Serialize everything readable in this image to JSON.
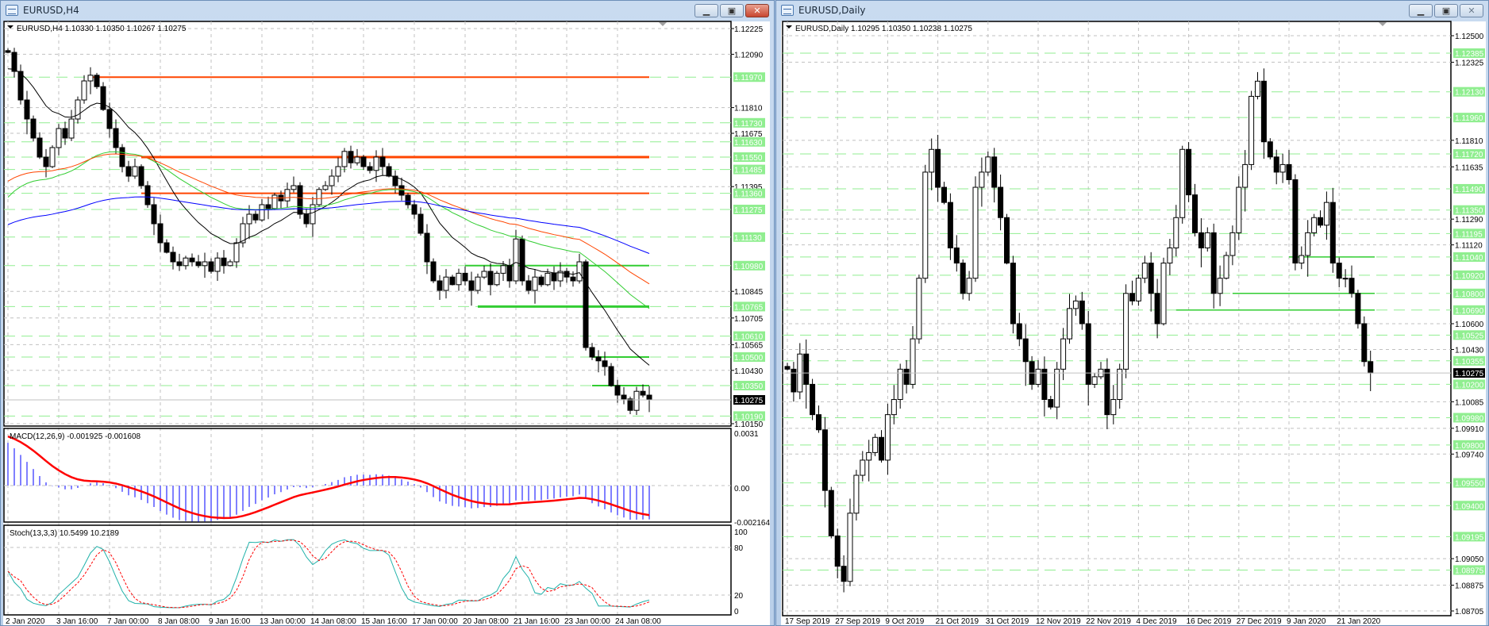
{
  "left": {
    "title": "EURUSD,H4",
    "info": "EURUSD,H4  1.10330 1.10350 1.10267 1.10275",
    "current_price": "1.10275",
    "price_labels": [
      "1.12225",
      "1.12090",
      "1.11810",
      "1.11675",
      "1.11395",
      "1.10845",
      "1.10705",
      "1.10565",
      "1.10430",
      "1.10150"
    ],
    "green_labels": [
      "1.11970",
      "1.11730",
      "1.11630",
      "1.11550",
      "1.11485",
      "1.11360",
      "1.11275",
      "1.11130",
      "1.10980",
      "1.10765",
      "1.10610",
      "1.10500",
      "1.10350",
      "1.10190"
    ],
    "levels": [
      {
        "price": 1.1197,
        "from_bar": 13,
        "color": "#ff4500",
        "weight": 2
      },
      {
        "price": 1.1155,
        "from_bar": 21,
        "color": "#ff4500",
        "weight": 3
      },
      {
        "price": 1.1136,
        "from_bar": 21,
        "color": "#ff4500",
        "weight": 2
      },
      {
        "price": 1.1098,
        "from_bar": 72,
        "color": "#32cd32",
        "weight": 2
      },
      {
        "price": 1.10765,
        "from_bar": 74,
        "color": "#32cd32",
        "weight": 3
      },
      {
        "price": 1.105,
        "from_bar": 92,
        "color": "#32cd32",
        "weight": 2
      },
      {
        "price": 1.1035,
        "from_bar": 92,
        "color": "#32cd32",
        "weight": 2
      }
    ],
    "dates": [
      "2 Jan 2020",
      "3 Jan 16:00",
      "7 Jan 00:00",
      "8 Jan 08:00",
      "9 Jan 16:00",
      "13 Jan 00:00",
      "14 Jan 08:00",
      "15 Jan 16:00",
      "17 Jan 00:00",
      "20 Jan 08:00",
      "21 Jan 16:00",
      "23 Jan 00:00",
      "24 Jan 08:00"
    ],
    "closes": [
      1.121,
      1.12,
      1.1185,
      1.1175,
      1.1165,
      1.1155,
      1.115,
      1.116,
      1.117,
      1.1165,
      1.1175,
      1.1185,
      1.1195,
      1.1198,
      1.1192,
      1.118,
      1.117,
      1.116,
      1.115,
      1.1145,
      1.115,
      1.114,
      1.113,
      1.112,
      1.111,
      1.1105,
      1.11,
      1.1098,
      1.1102,
      1.11,
      1.1098,
      1.11,
      1.1095,
      1.1102,
      1.1098,
      1.11,
      1.111,
      1.112,
      1.1125,
      1.1122,
      1.113,
      1.1128,
      1.1135,
      1.1132,
      1.1138,
      1.114,
      1.1125,
      1.112,
      1.113,
      1.1138,
      1.114,
      1.1145,
      1.115,
      1.1158,
      1.1152,
      1.1155,
      1.115,
      1.1148,
      1.1155,
      1.115,
      1.1145,
      1.114,
      1.1135,
      1.113,
      1.1125,
      1.1115,
      1.11,
      1.109,
      1.1085,
      1.1092,
      1.1088,
      1.1094,
      1.109,
      1.1085,
      1.1092,
      1.1095,
      1.1088,
      1.1094,
      1.1098,
      1.109,
      1.1112,
      1.109,
      1.1085,
      1.1092,
      1.1088,
      1.1094,
      1.109,
      1.1095,
      1.1092,
      1.109,
      1.11,
      1.1055,
      1.105,
      1.1048,
      1.1045,
      1.1035,
      1.103,
      1.1028,
      1.1022,
      1.1032,
      1.103,
      1.10275
    ],
    "ma_colors": [
      "#000000",
      "#32cd32",
      "#ff4500",
      "#0000ff"
    ],
    "macd": {
      "label": "MACD(12,26,9) -0.001925 -0.001608",
      "axis": [
        "0.0031",
        "0.00",
        "-0.002164"
      ],
      "hist_color": "#0000ff",
      "signal_color": "#ff0000"
    },
    "stoch": {
      "label": "Stoch(13,3,3) 10.5499 10.2189",
      "axis": [
        "100",
        "80",
        "20",
        "0"
      ],
      "main_color": "#20b2aa",
      "signal_color": "#ff0000"
    }
  },
  "right": {
    "title": "EURUSD,Daily",
    "info": "EURUSD,Daily  1.10295 1.10350 1.10238 1.10275",
    "current_price": "1.10275",
    "price_labels": [
      "1.12500",
      "1.12325",
      "1.11810",
      "1.11635",
      "1.11290",
      "1.11120",
      "1.10600",
      "1.10430",
      "1.10085",
      "1.09910",
      "1.09740",
      "1.09050",
      "1.08875",
      "1.08705"
    ],
    "green_labels": [
      "1.12385",
      "1.12130",
      "1.11960",
      "1.11720",
      "1.11490",
      "1.11350",
      "1.11195",
      "1.11040",
      "1.10920",
      "1.10800",
      "1.10690",
      "1.10525",
      "1.10355",
      "1.10200",
      "1.09980",
      "1.09800",
      "1.09550",
      "1.09400",
      "1.09195",
      "1.08975"
    ],
    "levels": [
      {
        "price": 1.1104,
        "from_bar": 80,
        "color": "#32cd32",
        "weight": 1.5
      },
      {
        "price": 1.108,
        "from_bar": 71,
        "color": "#32cd32",
        "weight": 1.5
      },
      {
        "price": 1.1069,
        "from_bar": 62,
        "color": "#32cd32",
        "weight": 1.5
      }
    ],
    "dates": [
      "17 Sep 2019",
      "27 Sep 2019",
      "9 Oct 2019",
      "21 Oct 2019",
      "31 Oct 2019",
      "12 Nov 2019",
      "22 Nov 2019",
      "4 Dec 2019",
      "16 Dec 2019",
      "27 Dec 2019",
      "9 Jan 2020",
      "21 Jan 2020"
    ],
    "closes": [
      1.103,
      1.1015,
      1.104,
      1.102,
      1.1,
      1.099,
      1.095,
      1.092,
      1.09,
      1.089,
      1.0935,
      1.096,
      1.097,
      1.0975,
      1.0985,
      1.097,
      1.1,
      1.101,
      1.103,
      1.102,
      1.105,
      1.109,
      1.116,
      1.1175,
      1.115,
      1.114,
      1.111,
      1.11,
      1.108,
      1.109,
      1.115,
      1.116,
      1.117,
      1.115,
      1.113,
      1.11,
      1.106,
      1.105,
      1.1035,
      1.102,
      1.103,
      1.101,
      1.1005,
      1.103,
      1.105,
      1.107,
      1.1075,
      1.106,
      1.102,
      1.1025,
      1.103,
      1.1,
      1.101,
      1.103,
      1.108,
      1.1075,
      1.109,
      1.11,
      1.108,
      1.106,
      1.11,
      1.111,
      1.113,
      1.1175,
      1.1145,
      1.112,
      1.111,
      1.112,
      1.108,
      1.109,
      1.1105,
      1.112,
      1.115,
      1.1165,
      1.121,
      1.122,
      1.118,
      1.117,
      1.116,
      1.1165,
      1.1155,
      1.11,
      1.1105,
      1.112,
      1.113,
      1.1125,
      1.114,
      1.11,
      1.109,
      1.109,
      1.108,
      1.106,
      1.1035,
      1.10275
    ]
  }
}
